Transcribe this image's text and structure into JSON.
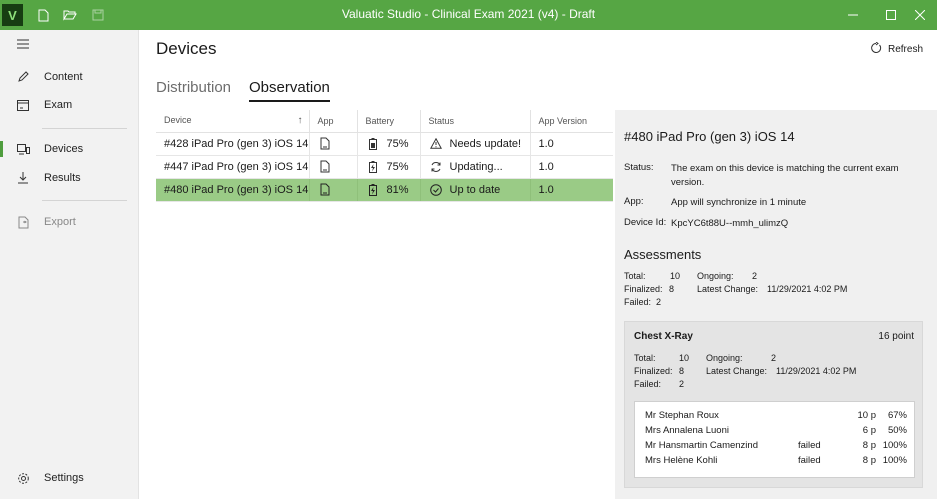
{
  "window": {
    "title": "Valuatic Studio - Clinical Exam 2021 (v4) - Draft",
    "logo": "V",
    "accent": "#56a644"
  },
  "sidebar": {
    "items": [
      {
        "label": "Content",
        "icon": "pencil-icon"
      },
      {
        "label": "Exam",
        "icon": "exam-icon"
      },
      {
        "label": "Devices",
        "icon": "devices-icon",
        "active": true
      },
      {
        "label": "Results",
        "icon": "download-icon"
      },
      {
        "label": "Export",
        "icon": "export-icon",
        "disabled": true
      }
    ],
    "settings": "Settings"
  },
  "main": {
    "title": "Devices",
    "refresh": "Refresh",
    "tabs": [
      {
        "label": "Distribution",
        "active": false
      },
      {
        "label": "Observation",
        "active": true
      }
    ]
  },
  "table": {
    "columns": [
      "Device",
      "App",
      "Battery",
      "Status",
      "App Version"
    ],
    "sort_indicator": "↑",
    "rows": [
      {
        "device": "#428 iPad Pro (gen 3) iOS 14",
        "battery": "75%",
        "status": "Needs update!",
        "status_icon": "warning-icon",
        "version": "1.0"
      },
      {
        "device": "#447 iPad Pro (gen 3) iOS 14",
        "battery": "75%",
        "status": "Updating...",
        "status_icon": "sync-icon",
        "version": "1.0"
      },
      {
        "device": "#480 iPad Pro (gen 3) iOS 14",
        "battery": "81%",
        "status": "Up to date",
        "status_icon": "check-circle-icon",
        "version": "1.0",
        "selected": true
      }
    ]
  },
  "detail": {
    "title": "#480 iPad Pro (gen 3) iOS 14",
    "status_label": "Status:",
    "status_value": "The exam on this device is matching the current exam version.",
    "app_label": "App:",
    "app_value": "App will synchronize in 1 minute",
    "device_id_label": "Device Id:",
    "device_id_value": "KpcYC6t88U--mmh_ulimzQ",
    "assessments_title": "Assessments",
    "stats": {
      "total_label": "Total:",
      "total": "10",
      "ongoing_label": "Ongoing:",
      "ongoing": "2",
      "finalized_label": "Finalized:",
      "finalized": "8",
      "latest_label": "Latest Change:",
      "latest": "11/29/2021 4:02 PM",
      "failed_label": "Failed:",
      "failed": "2"
    },
    "card": {
      "title": "Chest X-Ray",
      "points": "16 point",
      "stats": {
        "total_label": "Total:",
        "total": "10",
        "ongoing_label": "Ongoing:",
        "ongoing": "2",
        "finalized_label": "Finalized:",
        "finalized": "8",
        "latest_label": "Latest Change:",
        "latest": "11/29/2021 4:02 PM",
        "failed_label": "Failed:",
        "failed": "2"
      },
      "people": [
        {
          "name": "Mr Stephan Roux",
          "state": "",
          "points": "10 p",
          "percent": "67%"
        },
        {
          "name": "Mrs Annalena Luoni",
          "state": "",
          "points": "6 p",
          "percent": "50%"
        },
        {
          "name": "Mr Hansmartin Camenzind",
          "state": "failed",
          "points": "8 p",
          "percent": "100%"
        },
        {
          "name": "Mrs Helène Kohli",
          "state": "failed",
          "points": "8 p",
          "percent": "100%"
        }
      ]
    }
  }
}
